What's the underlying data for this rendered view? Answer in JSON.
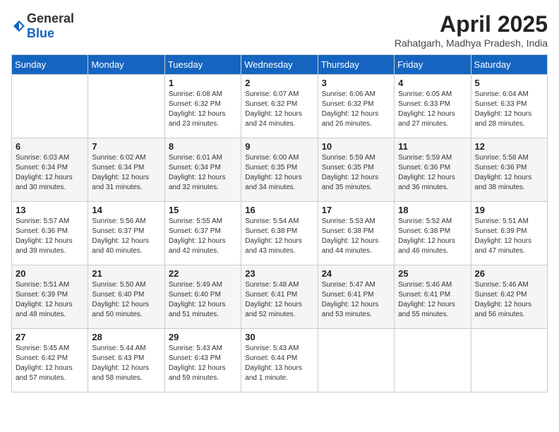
{
  "header": {
    "logo_general": "General",
    "logo_blue": "Blue",
    "month_year": "April 2025",
    "location": "Rahatgarh, Madhya Pradesh, India"
  },
  "days_of_week": [
    "Sunday",
    "Monday",
    "Tuesday",
    "Wednesday",
    "Thursday",
    "Friday",
    "Saturday"
  ],
  "weeks": [
    [
      {
        "day": "",
        "sunrise": "",
        "sunset": "",
        "daylight": ""
      },
      {
        "day": "",
        "sunrise": "",
        "sunset": "",
        "daylight": ""
      },
      {
        "day": "1",
        "sunrise": "Sunrise: 6:08 AM",
        "sunset": "Sunset: 6:32 PM",
        "daylight": "Daylight: 12 hours and 23 minutes."
      },
      {
        "day": "2",
        "sunrise": "Sunrise: 6:07 AM",
        "sunset": "Sunset: 6:32 PM",
        "daylight": "Daylight: 12 hours and 24 minutes."
      },
      {
        "day": "3",
        "sunrise": "Sunrise: 6:06 AM",
        "sunset": "Sunset: 6:32 PM",
        "daylight": "Daylight: 12 hours and 26 minutes."
      },
      {
        "day": "4",
        "sunrise": "Sunrise: 6:05 AM",
        "sunset": "Sunset: 6:33 PM",
        "daylight": "Daylight: 12 hours and 27 minutes."
      },
      {
        "day": "5",
        "sunrise": "Sunrise: 6:04 AM",
        "sunset": "Sunset: 6:33 PM",
        "daylight": "Daylight: 12 hours and 28 minutes."
      }
    ],
    [
      {
        "day": "6",
        "sunrise": "Sunrise: 6:03 AM",
        "sunset": "Sunset: 6:34 PM",
        "daylight": "Daylight: 12 hours and 30 minutes."
      },
      {
        "day": "7",
        "sunrise": "Sunrise: 6:02 AM",
        "sunset": "Sunset: 6:34 PM",
        "daylight": "Daylight: 12 hours and 31 minutes."
      },
      {
        "day": "8",
        "sunrise": "Sunrise: 6:01 AM",
        "sunset": "Sunset: 6:34 PM",
        "daylight": "Daylight: 12 hours and 32 minutes."
      },
      {
        "day": "9",
        "sunrise": "Sunrise: 6:00 AM",
        "sunset": "Sunset: 6:35 PM",
        "daylight": "Daylight: 12 hours and 34 minutes."
      },
      {
        "day": "10",
        "sunrise": "Sunrise: 5:59 AM",
        "sunset": "Sunset: 6:35 PM",
        "daylight": "Daylight: 12 hours and 35 minutes."
      },
      {
        "day": "11",
        "sunrise": "Sunrise: 5:59 AM",
        "sunset": "Sunset: 6:36 PM",
        "daylight": "Daylight: 12 hours and 36 minutes."
      },
      {
        "day": "12",
        "sunrise": "Sunrise: 5:58 AM",
        "sunset": "Sunset: 6:36 PM",
        "daylight": "Daylight: 12 hours and 38 minutes."
      }
    ],
    [
      {
        "day": "13",
        "sunrise": "Sunrise: 5:57 AM",
        "sunset": "Sunset: 6:36 PM",
        "daylight": "Daylight: 12 hours and 39 minutes."
      },
      {
        "day": "14",
        "sunrise": "Sunrise: 5:56 AM",
        "sunset": "Sunset: 6:37 PM",
        "daylight": "Daylight: 12 hours and 40 minutes."
      },
      {
        "day": "15",
        "sunrise": "Sunrise: 5:55 AM",
        "sunset": "Sunset: 6:37 PM",
        "daylight": "Daylight: 12 hours and 42 minutes."
      },
      {
        "day": "16",
        "sunrise": "Sunrise: 5:54 AM",
        "sunset": "Sunset: 6:38 PM",
        "daylight": "Daylight: 12 hours and 43 minutes."
      },
      {
        "day": "17",
        "sunrise": "Sunrise: 5:53 AM",
        "sunset": "Sunset: 6:38 PM",
        "daylight": "Daylight: 12 hours and 44 minutes."
      },
      {
        "day": "18",
        "sunrise": "Sunrise: 5:52 AM",
        "sunset": "Sunset: 6:38 PM",
        "daylight": "Daylight: 12 hours and 46 minutes."
      },
      {
        "day": "19",
        "sunrise": "Sunrise: 5:51 AM",
        "sunset": "Sunset: 6:39 PM",
        "daylight": "Daylight: 12 hours and 47 minutes."
      }
    ],
    [
      {
        "day": "20",
        "sunrise": "Sunrise: 5:51 AM",
        "sunset": "Sunset: 6:39 PM",
        "daylight": "Daylight: 12 hours and 48 minutes."
      },
      {
        "day": "21",
        "sunrise": "Sunrise: 5:50 AM",
        "sunset": "Sunset: 6:40 PM",
        "daylight": "Daylight: 12 hours and 50 minutes."
      },
      {
        "day": "22",
        "sunrise": "Sunrise: 5:49 AM",
        "sunset": "Sunset: 6:40 PM",
        "daylight": "Daylight: 12 hours and 51 minutes."
      },
      {
        "day": "23",
        "sunrise": "Sunrise: 5:48 AM",
        "sunset": "Sunset: 6:41 PM",
        "daylight": "Daylight: 12 hours and 52 minutes."
      },
      {
        "day": "24",
        "sunrise": "Sunrise: 5:47 AM",
        "sunset": "Sunset: 6:41 PM",
        "daylight": "Daylight: 12 hours and 53 minutes."
      },
      {
        "day": "25",
        "sunrise": "Sunrise: 5:46 AM",
        "sunset": "Sunset: 6:41 PM",
        "daylight": "Daylight: 12 hours and 55 minutes."
      },
      {
        "day": "26",
        "sunrise": "Sunrise: 5:46 AM",
        "sunset": "Sunset: 6:42 PM",
        "daylight": "Daylight: 12 hours and 56 minutes."
      }
    ],
    [
      {
        "day": "27",
        "sunrise": "Sunrise: 5:45 AM",
        "sunset": "Sunset: 6:42 PM",
        "daylight": "Daylight: 12 hours and 57 minutes."
      },
      {
        "day": "28",
        "sunrise": "Sunrise: 5:44 AM",
        "sunset": "Sunset: 6:43 PM",
        "daylight": "Daylight: 12 hours and 58 minutes."
      },
      {
        "day": "29",
        "sunrise": "Sunrise: 5:43 AM",
        "sunset": "Sunset: 6:43 PM",
        "daylight": "Daylight: 12 hours and 59 minutes."
      },
      {
        "day": "30",
        "sunrise": "Sunrise: 5:43 AM",
        "sunset": "Sunset: 6:44 PM",
        "daylight": "Daylight: 13 hours and 1 minute."
      },
      {
        "day": "",
        "sunrise": "",
        "sunset": "",
        "daylight": ""
      },
      {
        "day": "",
        "sunrise": "",
        "sunset": "",
        "daylight": ""
      },
      {
        "day": "",
        "sunrise": "",
        "sunset": "",
        "daylight": ""
      }
    ]
  ]
}
